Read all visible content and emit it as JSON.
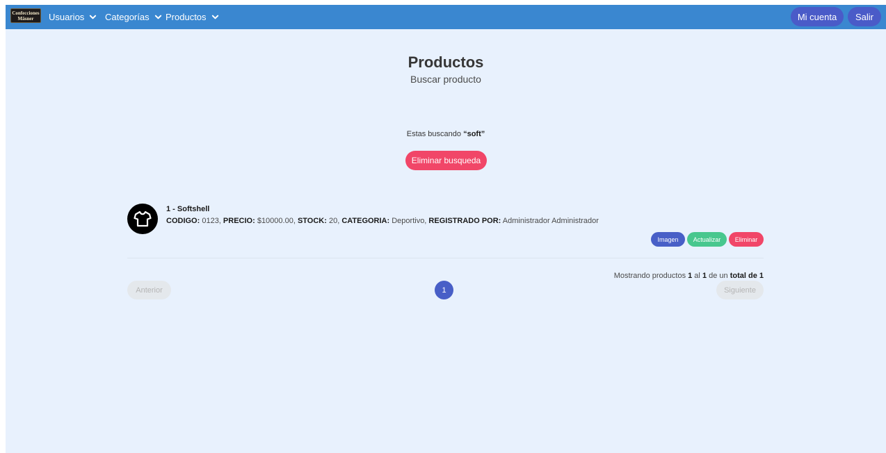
{
  "navbar": {
    "brand_line1": "Confecciones",
    "brand_line2": "Mäsner",
    "menu": [
      {
        "label": "Usuarios"
      },
      {
        "label": "Categorías"
      },
      {
        "label": "Productos"
      }
    ],
    "account_label": "Mi cuenta",
    "logout_label": "Salir"
  },
  "header": {
    "title": "Productos",
    "subtitle": "Buscar producto"
  },
  "search": {
    "prefix": "Estas buscando ",
    "term": "“soft”",
    "clear_label": "Eliminar busqueda"
  },
  "product": {
    "title": "1 - Softshell",
    "fields": [
      {
        "label": "CODIGO:",
        "value": " 0123, "
      },
      {
        "label": "PRECIO:",
        "value": " $10000.00, "
      },
      {
        "label": "STOCK:",
        "value": " 20, "
      },
      {
        "label": "CATEGORIA:",
        "value": " Deportivo, "
      },
      {
        "label": "REGISTRADO POR:",
        "value": " Administrador Administrador"
      }
    ],
    "actions": {
      "image_label": "Imagen",
      "update_label": "Actualizar",
      "delete_label": "Eliminar"
    }
  },
  "pagination": {
    "showing_prefix": "Mostrando productos ",
    "from": "1",
    "middle": " al ",
    "to": "1",
    "of_text": " de un ",
    "total_text": "total de 1",
    "prev_label": "Anterior",
    "current_page": "1",
    "next_label": "Siguiente"
  },
  "colors": {
    "navbar": "#3a87d0",
    "background": "#e8f1fd",
    "primary": "#485fc7",
    "success": "#48c78e",
    "danger": "#f14668"
  },
  "icons": {
    "product_avatar": "tshirt-icon",
    "dropdown": "chevron-down-icon"
  }
}
